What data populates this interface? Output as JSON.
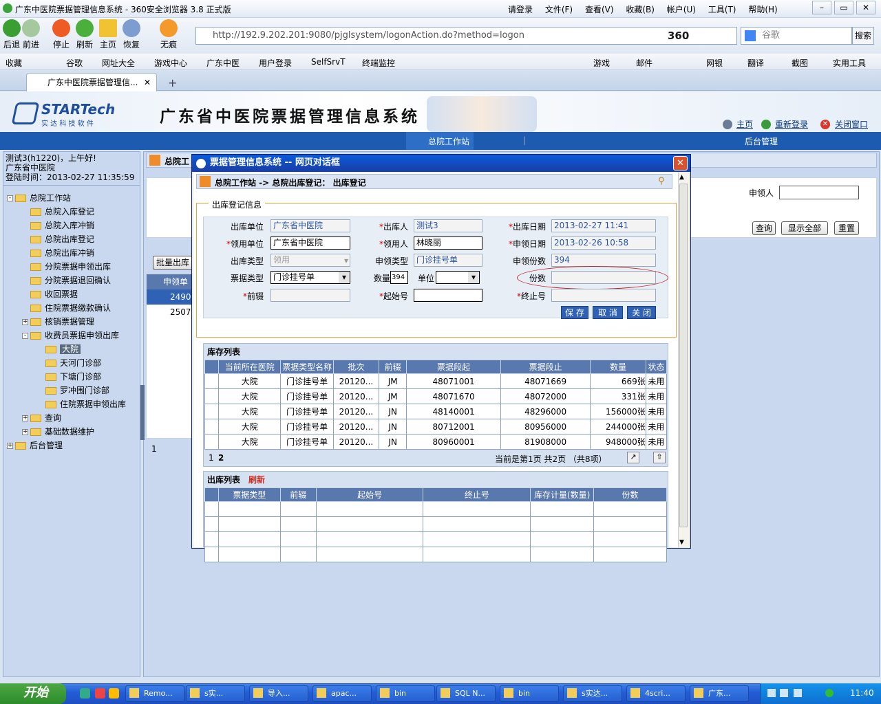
{
  "browser": {
    "window_title": "广东中医院票据管理信息系统 - 360安全浏览器 3.8 正式版",
    "menu": [
      "请登录",
      "文件(F)",
      "查看(V)",
      "收藏(B)",
      "帐户(U)",
      "工具(T)",
      "帮助(H)"
    ],
    "nav_buttons": [
      "后退",
      "前进",
      "停止",
      "刷新",
      "主页",
      "恢复",
      "无痕"
    ],
    "address": "http://192.9.202.201:9080/pjglsystem/logonAction.do?method=logon",
    "search_placeholder": "谷歌",
    "search_button": "搜索",
    "favorites": [
      "收藏",
      "谷歌",
      "网址大全",
      "游戏中心",
      "广东中医",
      "用户登录",
      "SelfSrvT",
      "终端监控"
    ],
    "tools_right": [
      "游戏",
      "邮件",
      "网银",
      "翻译",
      "截图",
      "实用工具"
    ],
    "tab_title": "广东中医院票据管理信...",
    "brand": "360"
  },
  "app": {
    "logo_text": "STARTech",
    "logo_sub": "实 达 科 技 软 件",
    "system_title": "广东省中医院票据管理信息系统",
    "header_links": [
      "主页",
      "重新登录",
      "关闭窗口"
    ],
    "band_items": [
      "总院工作站",
      "后台管理"
    ]
  },
  "user": {
    "greeting": "测试3(h1220)，上午好!",
    "org": "广东省中医院",
    "login_time": "登陆时间：2013-02-27 11:35:59"
  },
  "tree": [
    {
      "label": "总院工作站",
      "level": 0,
      "toggle": "-"
    },
    {
      "label": "总院入库登记",
      "level": 1
    },
    {
      "label": "总院入库冲销",
      "level": 1
    },
    {
      "label": "总院出库登记",
      "level": 1
    },
    {
      "label": "总院出库冲销",
      "level": 1
    },
    {
      "label": "分院票据申领出库",
      "level": 1
    },
    {
      "label": "分院票据退回确认",
      "level": 1
    },
    {
      "label": "收回票据",
      "level": 1
    },
    {
      "label": "住院票据缴款确认",
      "level": 1
    },
    {
      "label": "核销票据管理",
      "level": 1,
      "toggle": "+"
    },
    {
      "label": "收费员票据申领出库",
      "level": 1,
      "toggle": "-"
    },
    {
      "label": "大院",
      "level": 2,
      "selected": true
    },
    {
      "label": "天河门诊部",
      "level": 2
    },
    {
      "label": "下塘门诊部",
      "level": 2
    },
    {
      "label": "罗冲围门诊部",
      "level": 2
    },
    {
      "label": "住院票据申领出库",
      "level": 2
    },
    {
      "label": "查询",
      "level": 1,
      "toggle": "+"
    },
    {
      "label": "基础数据维护",
      "level": 1,
      "toggle": "+"
    },
    {
      "label": "后台管理",
      "level": 0,
      "toggle": "+"
    }
  ],
  "bg": {
    "crumb": "总院工",
    "applicant_label": "申领人",
    "buttons": [
      "查询",
      "显示全部",
      "重置"
    ],
    "batch_btn": "批量出库",
    "col_head": "申领单",
    "rows": [
      "2490",
      "2507"
    ],
    "page": "1"
  },
  "dialog": {
    "title": "票据管理信息系统 -- 网页对话框",
    "crumb": "总院工作站 -> 总院出库登记： 出库登记",
    "section": "出库登记信息",
    "fields": {
      "out_unit_label": "出库单位",
      "out_unit": "广东省中医院",
      "out_person_label": "出库人",
      "out_person": "测试3",
      "out_date_label": "出库日期",
      "out_date": "2013-02-27 11:41",
      "apply_unit_label": "领用单位",
      "apply_unit": "广东省中医院",
      "applicant_label": "领用人",
      "applicant": "林晓丽",
      "apply_date_label": "申领日期",
      "apply_date": "2013-02-26 10:58",
      "out_type_label": "出库类型",
      "out_type": "领用",
      "apply_type_label": "申领类型",
      "apply_type": "门诊挂号单",
      "apply_copies_label": "申领份数",
      "apply_copies": "394",
      "bill_type_label": "票据类型",
      "bill_type": "门诊挂号单",
      "qty_label": "数量",
      "qty": "394",
      "unit_label": "单位",
      "unit": "",
      "copies_label": "份数",
      "copies": "",
      "prefix_label": "前辍",
      "prefix": "",
      "start_label": "起始号",
      "start": "",
      "end_label": "终止号",
      "end": ""
    },
    "buttons": [
      "保 存",
      "取 消",
      "关 闭"
    ],
    "stock": {
      "title": "库存列表",
      "headers": [
        "当前所在医院",
        "票据类型名称",
        "批次",
        "前辍",
        "票据段起",
        "票据段止",
        "数量",
        "状态"
      ],
      "rows": [
        [
          "大院",
          "门诊挂号单",
          "20120...",
          "JM",
          "48071001",
          "48071669",
          "669张",
          "未用"
        ],
        [
          "大院",
          "门诊挂号单",
          "20120...",
          "JM",
          "48071670",
          "48072000",
          "331张",
          "未用"
        ],
        [
          "大院",
          "门诊挂号单",
          "20120...",
          "JN",
          "48140001",
          "48296000",
          "156000张",
          "未用"
        ],
        [
          "大院",
          "门诊挂号单",
          "20120...",
          "JN",
          "80712001",
          "80956000",
          "244000张",
          "未用"
        ],
        [
          "大院",
          "门诊挂号单",
          "20120...",
          "JN",
          "80960001",
          "81908000",
          "948000张",
          "未用"
        ]
      ],
      "pages": [
        "1",
        "2"
      ],
      "page_info": "当前是第1页  共2页 （共8项）"
    },
    "out_list": {
      "title": "出库列表",
      "refresh": "刷新",
      "headers": [
        "票据类型",
        "前辍",
        "起始号",
        "终止号",
        "库存计量(数量)",
        "份数"
      ]
    }
  },
  "taskbar": {
    "start": "开始",
    "tasks": [
      "Remo...",
      "s实...",
      "导入...",
      "apac...",
      "bin",
      "SQL N...",
      "bin",
      "s实达...",
      "4scri...",
      "广东..."
    ],
    "clock": "11:40"
  }
}
